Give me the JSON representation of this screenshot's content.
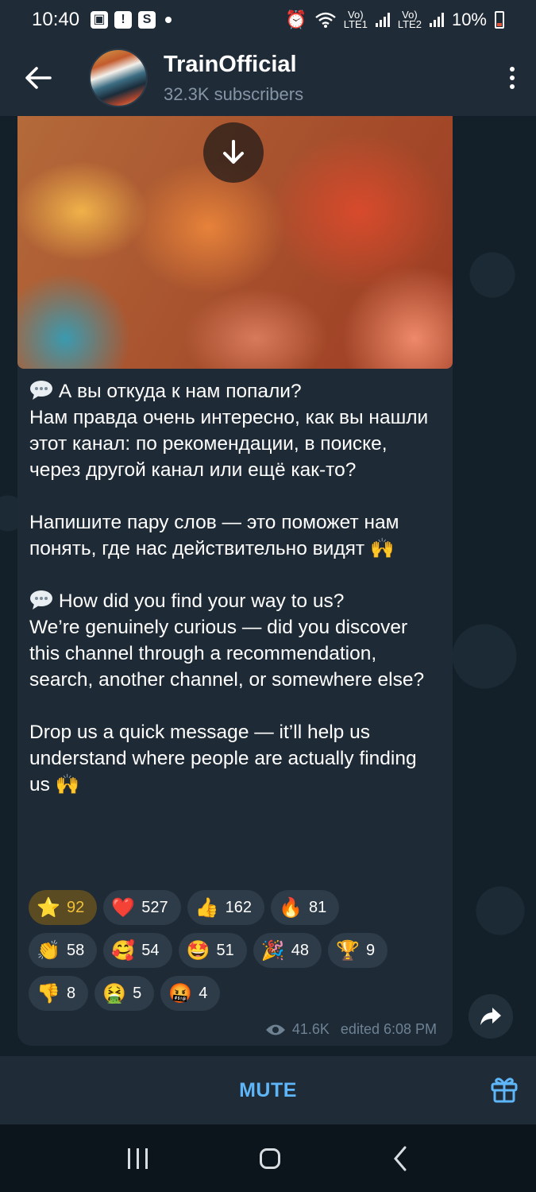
{
  "status_bar": {
    "time": "10:40",
    "sim1": "Vo)\nLTE1",
    "sim2": "Vo)\nLTE2",
    "battery": "10%"
  },
  "header": {
    "channel_name": "TrainOfficial",
    "subscribers": "32.3K subscribers"
  },
  "post": {
    "ru_paragraph_1_line_1": "А вы откуда к нам попали?",
    "ru_paragraph_1_rest": "Нам правда очень интересно, как вы нашли этот канал: по рекомендации, в поиске, через другой канал или ещё как-то?",
    "ru_paragraph_2": "Напишите пару слов — это поможет нам понять, где нас действительно видят",
    "en_paragraph_1_line_1": "How did you find your way to us?",
    "en_paragraph_1_rest": "We’re genuinely curious — did you discover this channel through a recommendation, search, another channel, or somewhere else?",
    "en_paragraph_2": "Drop us a quick message — it’ll help us understand where people are actually finding us",
    "views": "41.6K",
    "edited": "edited 6:08 PM"
  },
  "reactions": [
    [
      {
        "icon": "star",
        "glyph": "⭐",
        "count": "92",
        "active": true
      },
      {
        "icon": "heart",
        "glyph": "❤️",
        "count": "527"
      },
      {
        "icon": "thumbs-up",
        "glyph": "👍",
        "count": "162"
      },
      {
        "icon": "fire",
        "glyph": "🔥",
        "count": "81"
      }
    ],
    [
      {
        "icon": "clap",
        "glyph": "👏",
        "count": "58"
      },
      {
        "icon": "smiling-face-hearts",
        "glyph": "🥰",
        "count": "54"
      },
      {
        "icon": "star-struck",
        "glyph": "🤩",
        "count": "51"
      },
      {
        "icon": "party-popper",
        "glyph": "🎉",
        "count": "48"
      },
      {
        "icon": "trophy",
        "glyph": "🏆",
        "count": "9"
      }
    ],
    [
      {
        "icon": "thumbs-down",
        "glyph": "👎",
        "count": "8"
      },
      {
        "icon": "vomiting-face",
        "glyph": "🤮",
        "count": "5"
      },
      {
        "icon": "cursing-face",
        "glyph": "🤬",
        "count": "4"
      }
    ]
  ],
  "bottom_bar": {
    "mute_label": "MUTE"
  },
  "colors": {
    "accent": "#5eb5f7",
    "header_bg": "#1f2b37",
    "bubble_bg": "#1e2a35",
    "chat_bg": "#132029"
  }
}
